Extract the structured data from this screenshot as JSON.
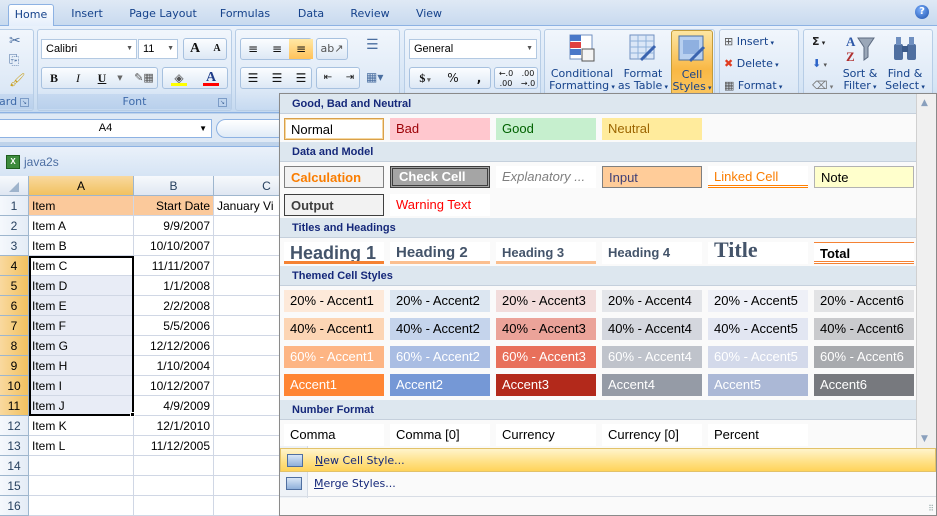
{
  "ribbon_tabs": [
    "Home",
    "Insert",
    "Page Layout",
    "Formulas",
    "Data",
    "Review",
    "View"
  ],
  "active_tab": "Home",
  "help_icon": "help-icon",
  "clipboard": {
    "label": "ard"
  },
  "font": {
    "name": "Calibri",
    "size": "11",
    "label": "Font",
    "bold": "B",
    "italic": "I",
    "underline": "U",
    "grow": "A",
    "shrink": "A",
    "font_color_letter": "A",
    "fill_color": "#ffff00",
    "font_color": "#ff0000"
  },
  "alignment": {
    "active": "bottom-align"
  },
  "number": {
    "format": "General",
    "currency": "$",
    "percent": "%",
    "comma": ",",
    "inc_decimal": ".00",
    "dec_decimal": ".0"
  },
  "styles": {
    "conditional_formatting": [
      "Conditional",
      "Formatting"
    ],
    "format_as_table": [
      "Format",
      "as Table"
    ],
    "cell_styles": [
      "Cell",
      "Styles"
    ]
  },
  "cells_group": {
    "insert": "Insert",
    "delete": "Delete",
    "format": "Format"
  },
  "editing": {
    "sum": "Σ",
    "sort_filter": [
      "Sort &",
      "Filter"
    ],
    "find_select": [
      "Find &",
      "Select"
    ]
  },
  "name_box": "A4",
  "workbook": {
    "title": "java2s"
  },
  "sheet": {
    "columns": [
      "A",
      "B",
      "C"
    ],
    "selected_column": "A",
    "rows": [
      {
        "n": "1",
        "a": "Item",
        "b": "Start Date",
        "c": "January Vi"
      },
      {
        "n": "2",
        "a": "Item A",
        "b": "9/9/2007",
        "c": ""
      },
      {
        "n": "3",
        "a": "Item B",
        "b": "10/10/2007",
        "c": ""
      },
      {
        "n": "4",
        "a": "Item C",
        "b": "11/11/2007",
        "c": ""
      },
      {
        "n": "5",
        "a": "Item D",
        "b": "1/1/2008",
        "c": ""
      },
      {
        "n": "6",
        "a": "Item E",
        "b": "2/2/2008",
        "c": ""
      },
      {
        "n": "7",
        "a": "Item F",
        "b": "5/5/2006",
        "c": ""
      },
      {
        "n": "8",
        "a": "Item G",
        "b": "12/12/2006",
        "c": ""
      },
      {
        "n": "9",
        "a": "Item H",
        "b": "1/10/2004",
        "c": ""
      },
      {
        "n": "10",
        "a": "Item I",
        "b": "10/12/2007",
        "c": ""
      },
      {
        "n": "11",
        "a": "Item J",
        "b": "4/9/2009",
        "c": ""
      },
      {
        "n": "12",
        "a": "Item K",
        "b": "12/1/2010",
        "c": ""
      },
      {
        "n": "13",
        "a": "Item L",
        "b": "11/12/2005",
        "c": ""
      },
      {
        "n": "14",
        "a": "",
        "b": "",
        "c": ""
      },
      {
        "n": "15",
        "a": "",
        "b": "",
        "c": ""
      },
      {
        "n": "16",
        "a": "",
        "b": "",
        "c": ""
      }
    ],
    "selected_range": "A4:A11"
  },
  "gallery": {
    "sections": [
      {
        "title": "Good, Bad and Neutral",
        "styles": [
          {
            "label": "Normal",
            "fg": "#000000",
            "bg": "#ffffff",
            "border": "#d9a04a"
          },
          {
            "label": "Bad",
            "fg": "#9c0006",
            "bg": "#ffc7ce"
          },
          {
            "label": "Good",
            "fg": "#006100",
            "bg": "#c6efce"
          },
          {
            "label": "Neutral",
            "fg": "#9c6500",
            "bg": "#ffeb9c"
          }
        ]
      },
      {
        "title": "Data and Model",
        "styles": [
          {
            "label": "Calculation",
            "fg": "#fa7d00",
            "bg": "#f2f2f2",
            "border": "#7f7f7f",
            "bold": true
          },
          {
            "label": "Check Cell",
            "fg": "#ffffff",
            "bg": "#a5a5a5",
            "border": "#3f3f3f",
            "bold": true
          },
          {
            "label": "Explanatory ...",
            "fg": "#7f7f7f",
            "bg": "#ffffff",
            "italic": true
          },
          {
            "label": "Input",
            "fg": "#3f3f76",
            "bg": "#ffcc99",
            "border": "#7f7f7f"
          },
          {
            "label": "Linked Cell",
            "fg": "#fa7d00",
            "bg": "#ffffff",
            "underline": "#ff8001"
          },
          {
            "label": "Note",
            "fg": "#000000",
            "bg": "#ffffcc",
            "border": "#b2b2b2"
          },
          {
            "label": "Output",
            "fg": "#3f3f3f",
            "bg": "#f2f2f2",
            "border": "#3f3f3f",
            "bold": true
          },
          {
            "label": "Warning Text",
            "fg": "#ff0000",
            "bg": "#ffffff"
          }
        ]
      },
      {
        "title": "Titles and Headings",
        "styles": [
          {
            "label": "Heading 1",
            "fg": "#44546a",
            "bg": "#ffffff",
            "underline": "#f58233",
            "size": "h1"
          },
          {
            "label": "Heading 2",
            "fg": "#44546a",
            "bg": "#ffffff",
            "underline": "#fbbf8f",
            "size": "h2"
          },
          {
            "label": "Heading 3",
            "fg": "#44546a",
            "bg": "#ffffff",
            "underline": "#fbbf8f",
            "size": "h3"
          },
          {
            "label": "Heading 4",
            "fg": "#44546a",
            "bg": "#ffffff",
            "size": "h4"
          },
          {
            "label": "Title",
            "fg": "#44546a",
            "bg": "#ffffff",
            "size": "title"
          },
          {
            "label": "Total",
            "fg": "#000000",
            "bg": "#ffffff",
            "underline": "#f58233",
            "topline": "#f58233",
            "bold": true
          }
        ]
      },
      {
        "title": "Themed Cell Styles",
        "styles": [
          {
            "label": "20% - Accent1",
            "fg": "#000000",
            "bg": "#fde9d9"
          },
          {
            "label": "20% - Accent2",
            "fg": "#000000",
            "bg": "#dce6f1"
          },
          {
            "label": "20% - Accent3",
            "fg": "#000000",
            "bg": "#f2dcdb"
          },
          {
            "label": "20% - Accent4",
            "fg": "#000000",
            "bg": "#e4e6ea"
          },
          {
            "label": "20% - Accent5",
            "fg": "#000000",
            "bg": "#eef0f7"
          },
          {
            "label": "20% - Accent6",
            "fg": "#000000",
            "bg": "#e2e3e5"
          },
          {
            "label": "40% - Accent1",
            "fg": "#000000",
            "bg": "#fcd5b4"
          },
          {
            "label": "40% - Accent2",
            "fg": "#000000",
            "bg": "#c5d4ec"
          },
          {
            "label": "40% - Accent3",
            "fg": "#000000",
            "bg": "#eba399"
          },
          {
            "label": "40% - Accent4",
            "fg": "#000000",
            "bg": "#d4d7de"
          },
          {
            "label": "40% - Accent5",
            "fg": "#000000",
            "bg": "#e2e6f2"
          },
          {
            "label": "40% - Accent6",
            "fg": "#000000",
            "bg": "#c9cacd"
          },
          {
            "label": "60% - Accent1",
            "fg": "#ffffff",
            "bg": "#fdb584"
          },
          {
            "label": "60% - Accent2",
            "fg": "#ffffff",
            "bg": "#a9bde3"
          },
          {
            "label": "60% - Accent3",
            "fg": "#ffffff",
            "bg": "#e8705b"
          },
          {
            "label": "60% - Accent4",
            "fg": "#ffffff",
            "bg": "#bfc3cb"
          },
          {
            "label": "60% - Accent5",
            "fg": "#ffffff",
            "bg": "#d3d9ea"
          },
          {
            "label": "60% - Accent6",
            "fg": "#ffffff",
            "bg": "#a8aaae"
          },
          {
            "label": "Accent1",
            "fg": "#ffffff",
            "bg": "#ff8533"
          },
          {
            "label": "Accent2",
            "fg": "#ffffff",
            "bg": "#7598d6"
          },
          {
            "label": "Accent3",
            "fg": "#ffffff",
            "bg": "#b3291b"
          },
          {
            "label": "Accent4",
            "fg": "#ffffff",
            "bg": "#959ba6"
          },
          {
            "label": "Accent5",
            "fg": "#ffffff",
            "bg": "#abb8d6"
          },
          {
            "label": "Accent6",
            "fg": "#ffffff",
            "bg": "#77797e"
          }
        ]
      },
      {
        "title": "Number Format",
        "styles": [
          {
            "label": "Comma",
            "fg": "#000000",
            "bg": "#ffffff"
          },
          {
            "label": "Comma [0]",
            "fg": "#000000",
            "bg": "#ffffff"
          },
          {
            "label": "Currency",
            "fg": "#000000",
            "bg": "#ffffff"
          },
          {
            "label": "Currency [0]",
            "fg": "#000000",
            "bg": "#ffffff"
          },
          {
            "label": "Percent",
            "fg": "#000000",
            "bg": "#ffffff"
          }
        ]
      }
    ],
    "menu": [
      {
        "label": "New Cell Style...",
        "accel": "N",
        "rest": "ew Cell Style...",
        "icon": "new-cell-style-icon",
        "highlighted": true
      },
      {
        "label": "Merge Styles...",
        "accel": "M",
        "rest": "erge Styles...",
        "icon": "merge-styles-icon",
        "highlighted": false
      }
    ]
  }
}
